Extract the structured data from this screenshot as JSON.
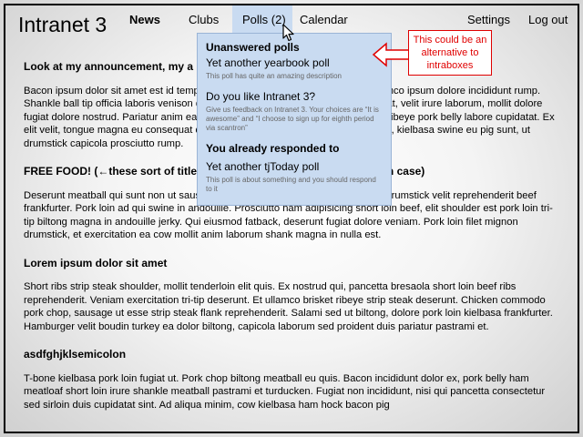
{
  "app": {
    "title": "Intranet 3"
  },
  "nav": {
    "news": "News",
    "clubs": "Clubs",
    "polls": "Polls (2)",
    "calendar": "Calendar",
    "settings": "Settings",
    "logout": "Log out"
  },
  "polls_dropdown": {
    "unanswered_heading": "Unanswered polls",
    "unanswered": [
      {
        "title": "Yet another yearbook poll",
        "desc": "This poll has quite an amazing description"
      },
      {
        "title": "Do you like Intranet 3?",
        "desc": "Give us feedback on Intranet 3.  Your choices are “It is awesome” and “I choose to sign up for eighth period via scantron”"
      }
    ],
    "responded_heading": "You already responded to",
    "responded": [
      {
        "title": "Yet another tjToday poll",
        "desc": "This poll is about something and you should respond to it"
      }
    ]
  },
  "annotation": {
    "text": "This could be an alternative to intraboxes",
    "color": "#e00000"
  },
  "articles": [
    {
      "title": "Look at my announcement, my a",
      "body": "Bacon ipsum dolor sit amet est id tempor eiusmod flank incididunt pork belly ullamco ipsum dolore incididunt rump. Shankle ball tip officia laboris venison drumstick aute capicola do chicken ex fugiat, velit irure laborum, mollit dolore fugiat dolore nostrud. Pariatur anim ea in dolore, velit pastrami excepteur pig tail ribeye pork belly labore cupidatat. Ex elit velit, tongue magna eu consequat quis. Short loin filet mignon do minim sirloin, kielbasa swine eu pig sunt, ut drumstick capicola prosciutto rump."
    },
    {
      "title": "FREE FOOD!  (←these sort of titles would probably be in the preview, in case)",
      "body": "Deserunt meatball qui sunt non ut sausage corned beef andouille in tail tongue. Drumstick velit reprehenderit beef frankfurter. Pork loin ad qui swine in andouille. Prosciutto ham adipisicing short loin beef, elit shoulder est pork loin tri-tip biltong magna in andouille jerky. Qui eiusmod fatback, deserunt fugiat dolore veniam. Pork loin filet mignon drumstick, et exercitation ea cow mollit anim laborum shank magna in nulla est."
    },
    {
      "title": "Lorem ipsum dolor sit amet",
      "body": "Short ribs strip steak shoulder, mollit tenderloin elit quis. Ex nostrud qui, pancetta bresaola short loin beef ribs reprehenderit. Veniam exercitation tri-tip deserunt. Et ullamco brisket ribeye strip steak deserunt. Chicken commodo pork chop, sausage ut esse strip steak flank reprehenderit. Salami sed ut biltong, dolore pork loin kielbasa frankfurter. Hamburger velit boudin turkey ea dolor biltong, capicola laborum sed proident duis pariatur pastrami et."
    },
    {
      "title": "asdfghjklsemicolon",
      "body": "T-bone kielbasa pork loin fugiat ut. Pork chop biltong meatball eu quis. Bacon incididunt dolor ex, pork belly ham meatloaf short loin irure shankle meatball pastrami et turducken. Fugiat non incididunt, nisi qui pancetta consectetur sed sirloin duis cupidatat sint. Ad aliqua minim, cow kielbasa ham hock bacon pig"
    }
  ]
}
